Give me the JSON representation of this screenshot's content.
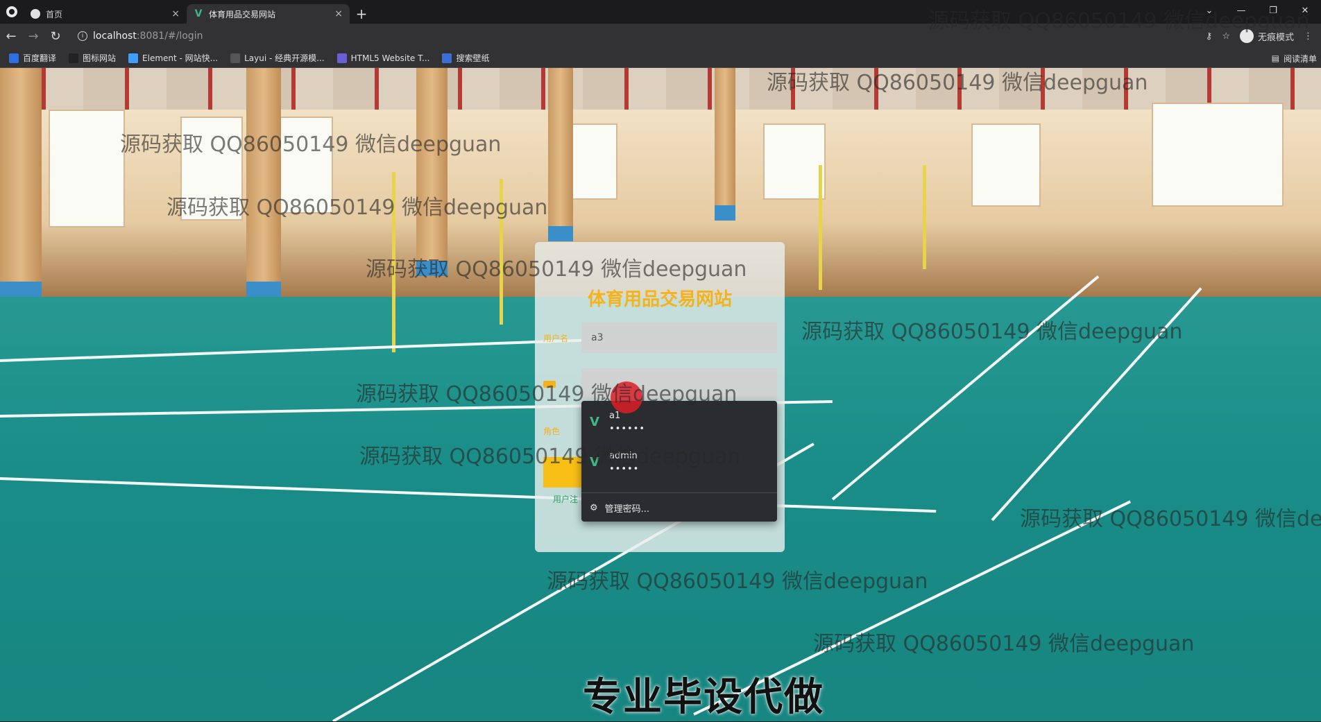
{
  "browser": {
    "tabs": [
      {
        "title": "首页",
        "active": false,
        "icon": "globe-icon"
      },
      {
        "title": "体育用品交易网站",
        "active": true,
        "icon": "vue-logo-icon"
      }
    ],
    "new_tab": "+",
    "close_glyph": "×",
    "url": {
      "host": "localhost",
      "path": ":8081/#/login"
    },
    "incognito_label": "无痕模式",
    "bookmarks": [
      {
        "label": "百度翻译",
        "color": "#2f6fe0"
      },
      {
        "label": "图标网站",
        "color": "#222222"
      },
      {
        "label": "Element - 网站快...",
        "color": "#409eff"
      },
      {
        "label": "Layui - 经典开源模...",
        "color": "#555555"
      },
      {
        "label": "HTML5 Website T...",
        "color": "#6b5fd6"
      },
      {
        "label": "搜索壁纸",
        "color": "#3a6fd8"
      }
    ],
    "reading_list": "阅读清单"
  },
  "login": {
    "title": "体育用品交易网站",
    "username_label": "用户名",
    "username_value": "a3",
    "role_label": "角色",
    "register_link": "用户注"
  },
  "autofill": {
    "items": [
      {
        "username": "a1",
        "password_mask": "••••••"
      },
      {
        "username": "admin",
        "password_mask": "•••••"
      }
    ],
    "manage_label": "管理密码..."
  },
  "watermark_text": "源码获取 QQ86050149 微信deepguan",
  "caption": "专业毕设代做",
  "colors": {
    "accent": "#f5b21b",
    "register": "#1fa45e",
    "vue": "#41b883"
  }
}
